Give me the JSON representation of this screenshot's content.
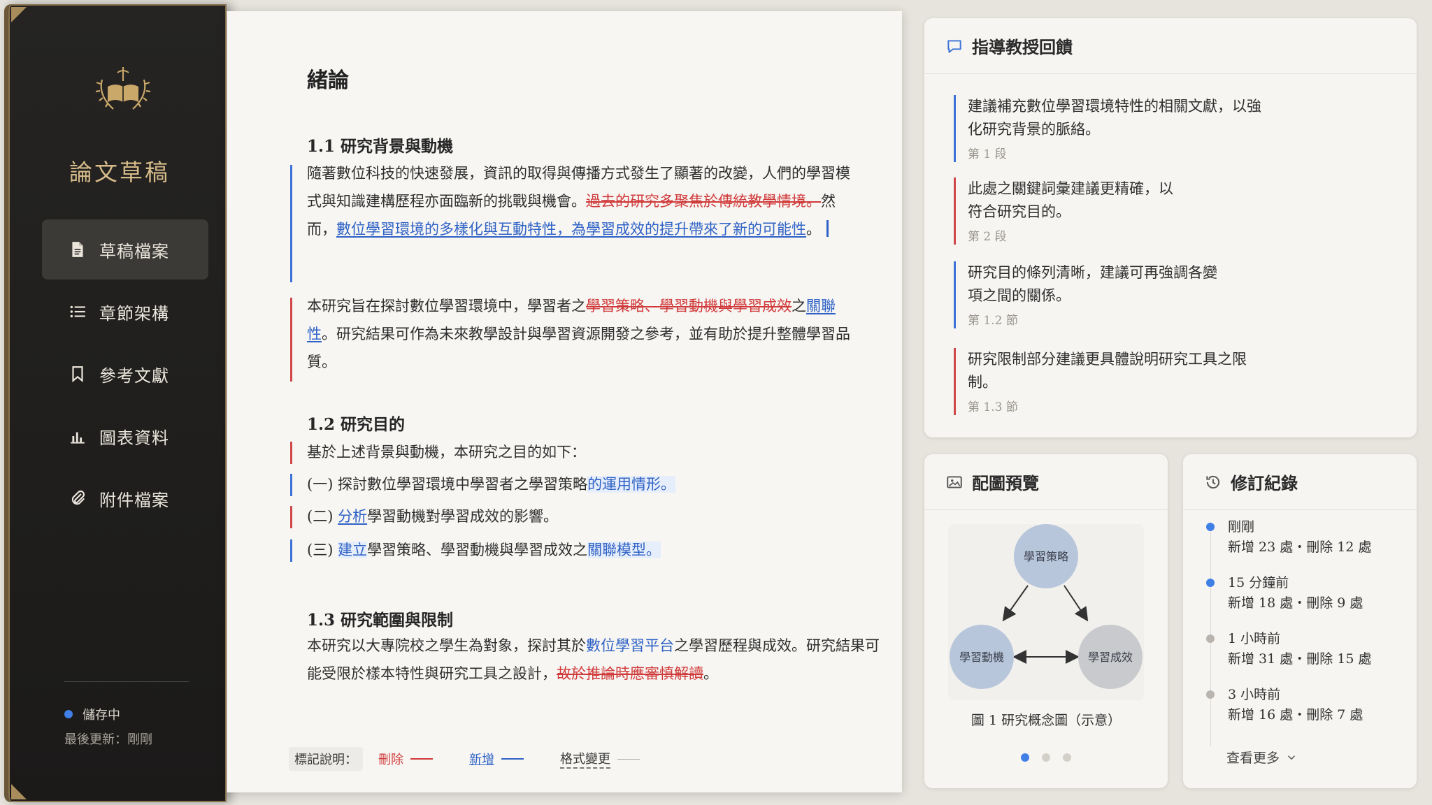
{
  "sidebar": {
    "title": "論文草稿",
    "items": [
      {
        "label": "草稿檔案",
        "active": true
      },
      {
        "label": "章節架構"
      },
      {
        "label": "參考文獻"
      },
      {
        "label": "圖表資料"
      },
      {
        "label": "附件檔案"
      }
    ],
    "save_status": "儲存中",
    "last_update": "最後更新：剛剛"
  },
  "doc": {
    "title": "緒論",
    "s11": "1.1 研究背景與動機",
    "p1": {
      "a": "隨著數位科技的快速發展，資訊的取得與傳播方式發生了顯著的改變，人們的學習模式與知識建構歷程亦面臨新的挑戰與機會。",
      "del1": "過去的研究多聚焦於傳統教學情境。",
      "b": "然而，",
      "ins1": "數位學習環境的多樣化與互動特性，為學習成效的提升帶來了新的可能性",
      "c": "。"
    },
    "p2": {
      "a": "本研究旨在探討數位學習環境中，學習者之",
      "del1": "學習策略、學習動機與學習成效",
      "b": "之",
      "ins1": "關聯性",
      "c": "。研究結果可作為未來教學設計與學習資源開發之參考，並有助於提升整體學習品質。"
    },
    "s12": "1.2 研究目的",
    "p3": "基於上述背景與動機，本研究之目的如下：",
    "li1": {
      "a": "(一) 探討數位學習環境中學習者之學習策略",
      "ins": "的運用情形。"
    },
    "li2": {
      "a": "(二) ",
      "ins": "分析",
      "b": "學習動機對學習成效的影響。"
    },
    "li3": {
      "a": "(三) ",
      "ins1": "建立",
      "b": "學習策略、學習動機與學習成效之",
      "ins2": "關聯模型。"
    },
    "s13": "1.3 研究範圍與限制",
    "p4": {
      "a": "本研究以大專院校之學生為對象，探討其於",
      "ins1": "數位學習平台",
      "b": "之學習歷程與成效。研究結果可能受限於樣本特性與研究工具之設計，",
      "del1": "故於推論時應審慎解讀",
      "c": "。"
    },
    "legend": {
      "label": "標記說明：",
      "del": "刪除",
      "ins": "新增",
      "fmt": "格式變更"
    }
  },
  "feedback": {
    "title": "指導教授回饋",
    "items": [
      {
        "text": "建議補充數位學習環境特性的相關文獻，以強化研究背景的脈絡。",
        "meta": "第 1 段",
        "color": "#3d72d6"
      },
      {
        "text": "此處之關鍵詞彙建議更精確，以符合研究目的。",
        "meta": "第 2 段",
        "color": "#d04848"
      },
      {
        "text": "研究目的條列清晰，建議可再強調各變項之間的關係。",
        "meta": "第 1.2 節",
        "color": "#3d72d6"
      },
      {
        "text": "研究限制部分建議更具體說明研究工具之限制。",
        "meta": "第 1.3 節",
        "color": "#d04848"
      }
    ]
  },
  "figure": {
    "title": "配圖預覽",
    "nodes": [
      "學習策略",
      "學習動機",
      "學習成效"
    ],
    "caption": "圖 1 研究概念圖（示意）"
  },
  "revisions": {
    "title": "修訂紀錄",
    "items": [
      {
        "time": "剛剛",
        "detail": "新增 23 處・刪除 12 處",
        "color": "#3f7fe6"
      },
      {
        "time": "15 分鐘前",
        "detail": "新增 18 處・刪除 9 處",
        "color": "#3f7fe6"
      },
      {
        "time": "1 小時前",
        "detail": "新增 31 處・刪除 15 處",
        "color": "#b9b5ae"
      },
      {
        "time": "3 小時前",
        "detail": "新增 16 處・刪除 7 處",
        "color": "#b9b5ae"
      }
    ],
    "more": "查看更多"
  }
}
